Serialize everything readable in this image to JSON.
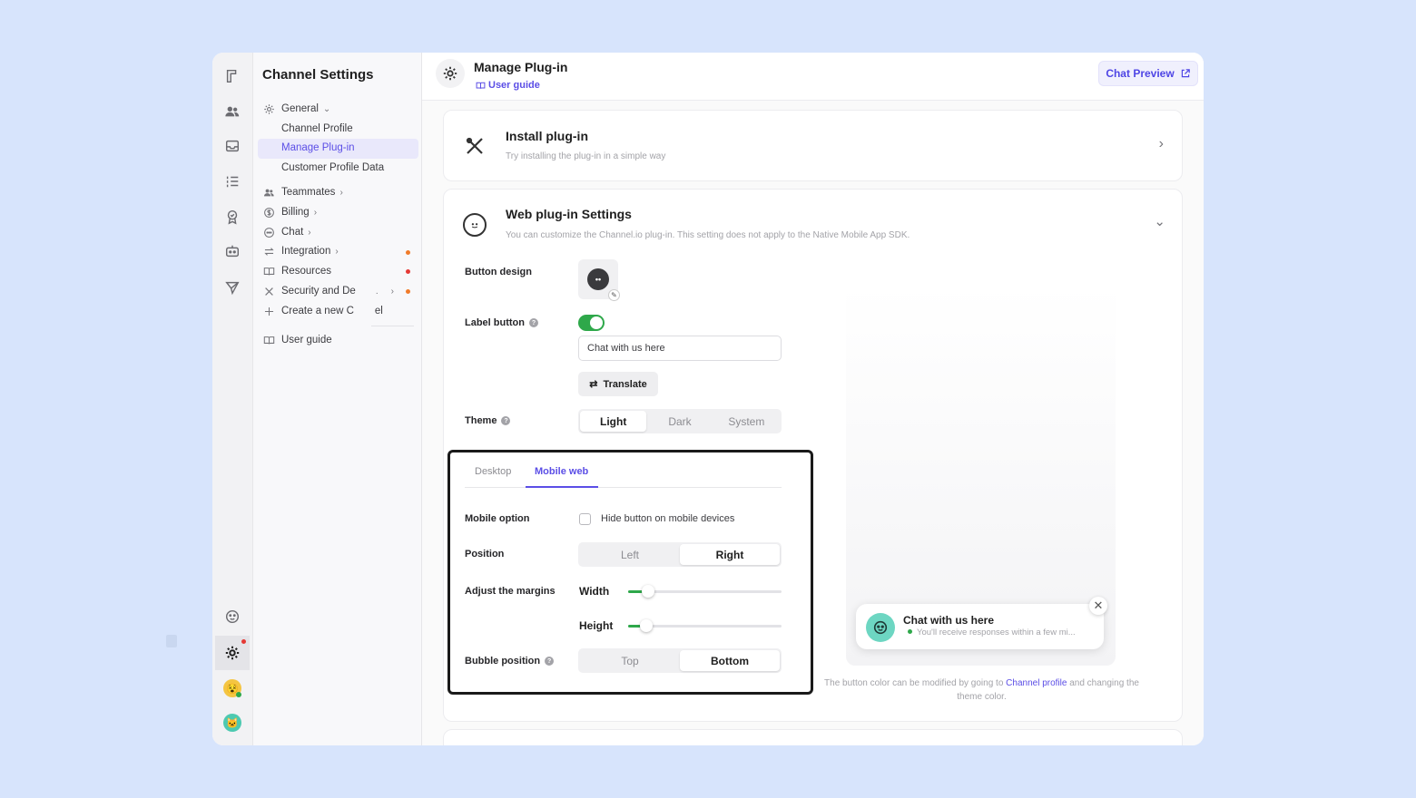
{
  "sidebar": {
    "title": "Channel Settings",
    "general": "General",
    "sub_items": [
      "Channel Profile",
      "Manage Plug-in",
      "Customer Profile Data"
    ],
    "items": [
      "Teammates",
      "Billing",
      "Chat",
      "Integration",
      "Resources",
      "Security and De",
      "Create a new C"
    ],
    "create_tail": "el",
    "user_guide": "User guide"
  },
  "header": {
    "title": "Manage Plug-in",
    "guide": "User guide",
    "preview": "Chat Preview"
  },
  "install": {
    "title": "Install plug-in",
    "desc": "Try installing the plug-in in a simple way"
  },
  "web": {
    "title": "Web plug-in Settings",
    "desc": "You can customize the Channel.io plug-in. This setting does not apply to the Native Mobile App SDK.",
    "button_design": "Button design",
    "label_button": "Label button",
    "label_value": "Chat with us here",
    "translate": "Translate",
    "theme": "Theme",
    "theme_options": [
      "Light",
      "Dark",
      "System"
    ],
    "theme_selected": "Light",
    "tabs": [
      "Desktop",
      "Mobile web"
    ],
    "tab_selected": "Mobile web",
    "mobile_option": "Mobile option",
    "hide_button": "Hide button on mobile devices",
    "position": "Position",
    "position_options": [
      "Left",
      "Right"
    ],
    "position_selected": "Right",
    "margins": "Adjust the margins",
    "width": "Width",
    "height": "Height",
    "width_value": 0.11,
    "height_value": 0.1,
    "bubble_position": "Bubble position",
    "bubble_options": [
      "Top",
      "Bottom"
    ],
    "bubble_selected": "Bottom"
  },
  "preview": {
    "bubble_title": "Chat with us here",
    "bubble_sub": "You'll receive responses within a few mi...",
    "note_before": "The button color can be modified by going to ",
    "note_link": "Channel profile",
    "note_after": " and changing the theme color."
  },
  "colors": {
    "accent": "#5b4ee6",
    "toggle": "#2ea84a",
    "slider": "#2ea84a"
  }
}
